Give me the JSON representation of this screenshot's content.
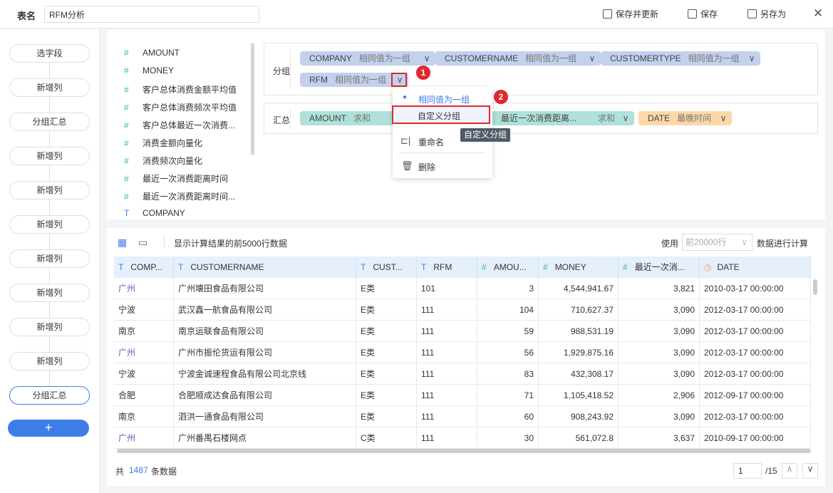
{
  "header": {
    "table_name_label": "表名",
    "table_name_value": "RFM分析",
    "save_update": "保存并更新",
    "save": "保存",
    "save_as": "另存为"
  },
  "steps": [
    "选字段",
    "新增列",
    "分组汇总",
    "新增列",
    "新增列",
    "新增列",
    "新增列",
    "新增列",
    "新增列",
    "新增列",
    "分组汇总"
  ],
  "add_label": "+",
  "fields": [
    {
      "t": "#",
      "n": "AMOUNT"
    },
    {
      "t": "#",
      "n": "MONEY"
    },
    {
      "t": "#",
      "n": "客户总体消费金额平均值"
    },
    {
      "t": "#",
      "n": "客户总体消费频次平均值"
    },
    {
      "t": "#",
      "n": "客户总体最近一次消费..."
    },
    {
      "t": "#",
      "n": "消费金额向量化"
    },
    {
      "t": "#",
      "n": "消费频次向量化"
    },
    {
      "t": "#",
      "n": "最近一次消费距离时间"
    },
    {
      "t": "#",
      "n": "最近一次消费距离时间..."
    },
    {
      "t": "T",
      "n": "COMPANY"
    }
  ],
  "group": {
    "label": "分组",
    "chips": [
      {
        "name": "COMPANY",
        "mode": "相同值为一组"
      },
      {
        "name": "CUSTOMERNAME",
        "mode": "相同值为一组"
      },
      {
        "name": "CUSTOMERTYPE",
        "mode": "相同值为一组"
      },
      {
        "name": "RFM",
        "mode": "相同值为一组"
      }
    ]
  },
  "summary": {
    "label": "汇总",
    "chips": [
      {
        "name": "AMOUNT",
        "mode": "求和"
      },
      {
        "name": "最近一次消费距离...",
        "mode": "求和"
      },
      {
        "name": "DATE",
        "mode": "最晚时间"
      }
    ]
  },
  "menu": {
    "items": [
      "相同值为一组",
      "自定义分组",
      "重命名",
      "删除"
    ],
    "tooltip": "自定义分组",
    "badges": [
      "1",
      "2"
    ]
  },
  "table": {
    "info": "显示计算结果的前5000行数据",
    "use_label": "使用",
    "use_value": "前20000行",
    "use_suffix": "数据进行计算",
    "columns": [
      {
        "t": "T",
        "n": "COMP..."
      },
      {
        "t": "T",
        "n": "CUSTOMERNAME"
      },
      {
        "t": "T",
        "n": "CUST..."
      },
      {
        "t": "T",
        "n": "RFM"
      },
      {
        "t": "#",
        "n": "AMOU..."
      },
      {
        "t": "#",
        "n": "MONEY"
      },
      {
        "t": "#",
        "n": "最近一次消..."
      },
      {
        "t": "D",
        "n": "DATE"
      }
    ],
    "rows": [
      [
        "广州",
        "广州壊田食品有限公司",
        "E类",
        "101",
        "3",
        "4,544,941.67",
        "3,821",
        "2010-03-17 00:00:00"
      ],
      [
        "宁波",
        "武汉鑫一航食品有限公司",
        "E类",
        "111",
        "104",
        "710,627.37",
        "3,090",
        "2012-03-17 00:00:00"
      ],
      [
        "南京",
        "南京运联食品有限公司",
        "E类",
        "111",
        "59",
        "988,531.19",
        "3,090",
        "2012-03-17 00:00:00"
      ],
      [
        "广州",
        "广州市振伦货运有限公司",
        "E类",
        "111",
        "56",
        "1,929,875.16",
        "3,090",
        "2012-03-17 00:00:00"
      ],
      [
        "宁波",
        "宁波金诚速程食品有限公司北京线",
        "E类",
        "111",
        "83",
        "432,308.17",
        "3,090",
        "2012-03-17 00:00:00"
      ],
      [
        "合肥",
        "合肥顺成达食品有限公司",
        "E类",
        "111",
        "71",
        "1,105,418.52",
        "2,906",
        "2012-09-17 00:00:00"
      ],
      [
        "南京",
        "泗洪一通食品有限公司",
        "E类",
        "111",
        "60",
        "908,243.92",
        "3,090",
        "2012-03-17 00:00:00"
      ],
      [
        "广州",
        "广州番禺石楼网点",
        "C类",
        "111",
        "30",
        "561,072.8",
        "3,637",
        "2010-09-17 00:00:00"
      ]
    ]
  },
  "footer": {
    "prefix": "共",
    "count": "1487",
    "suffix": "条数据",
    "page": "1",
    "total": "/15"
  }
}
